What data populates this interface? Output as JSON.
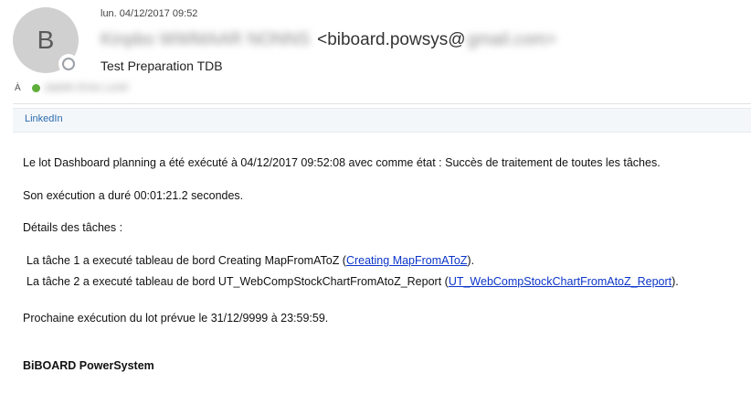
{
  "header": {
    "avatar_letter": "B",
    "date": "lun. 04/12/2017 09:52",
    "from_name": "Kinpbo WWMAAR NONNS",
    "from_email_visible": "<biboard.powsys@",
    "from_email_blurred": "gmail.com>",
    "subject": "Test Preparation TDB",
    "to_label": "À",
    "to_value": "Jadolin Emis Lontrl"
  },
  "attachment": {
    "label": "LinkedIn"
  },
  "body": {
    "para1": "Le lot Dashboard planning a été exécuté à 04/12/2017 09:52:08 avec comme état : Succès de traitement de toutes les tâches.",
    "para2": "Son exécution a duré 00:01:21.2 secondes.",
    "para3": "Détails des tâches :",
    "tasks": [
      {
        "prefix": "La tâche 1 a executé tableau de bord Creating MapFromAToZ (",
        "link": "Creating MapFromAToZ",
        "suffix": ")."
      },
      {
        "prefix": "La tâche 2 a executé tableau de bord UT_WebCompStockChartFromAtoZ_Report (",
        "link": "UT_WebCompStockChartFromAtoZ_Report",
        "suffix": ")."
      }
    ],
    "para4": "Prochaine exécution du lot prévue le 31/12/9999 à 23:59:59.",
    "signature": "BiBOARD PowerSystem"
  }
}
